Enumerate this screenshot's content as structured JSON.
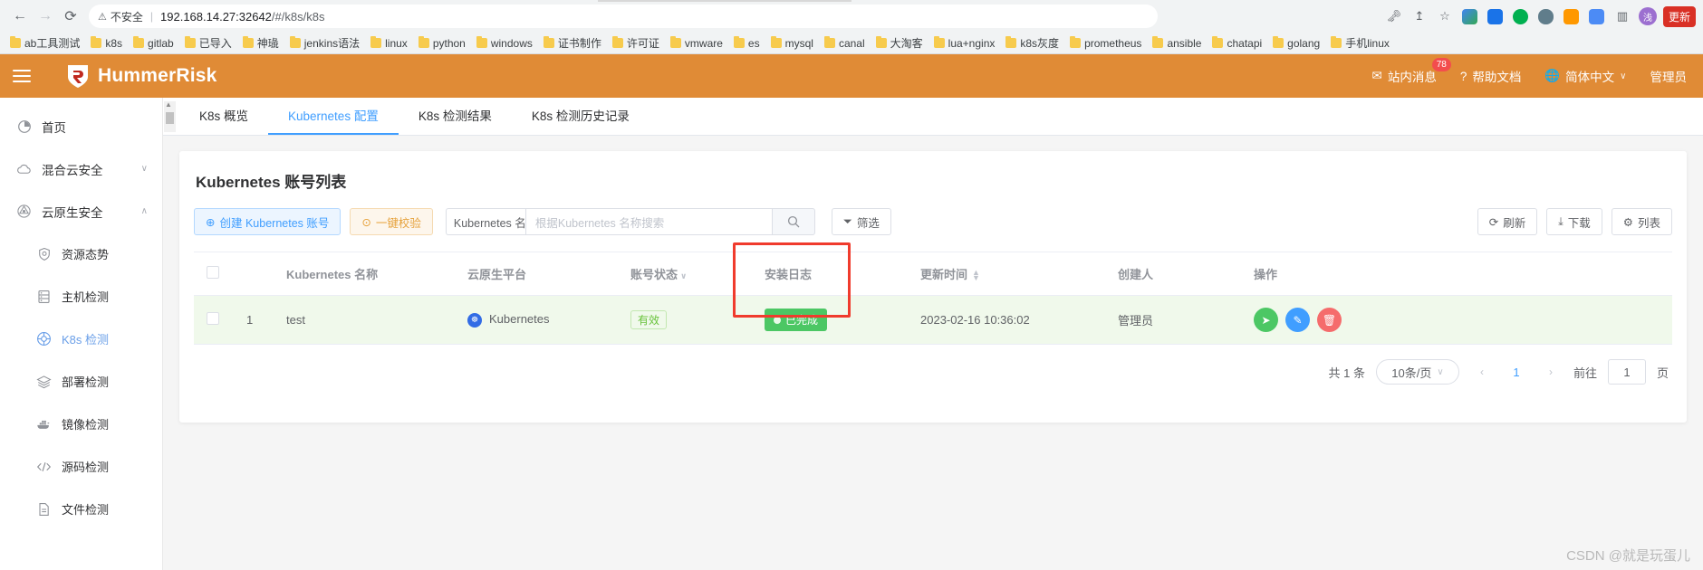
{
  "browser": {
    "back_icon": "arrow-left-icon",
    "forward_icon": "arrow-right-icon",
    "reload_icon": "reload-icon",
    "insecure_label": "不安全",
    "url": "192.168.14.27:32642",
    "url_path": "/#/k8s/k8s",
    "actions": {
      "key_icon": "key-icon",
      "share_icon": "share-icon",
      "star_icon": "star-icon",
      "avatar_initial": "浅",
      "update_label": "更新"
    },
    "bookmarks": [
      "ab工具测试",
      "k8s",
      "gitlab",
      "已导入",
      "神璏",
      "jenkins语法",
      "linux",
      "python",
      "windows",
      "证书制作",
      "许可证",
      "vmware",
      "es",
      "mysql",
      "canal",
      "大淘客",
      "lua+nginx",
      "k8s灰度",
      "prometheus",
      "ansible",
      "chatapi",
      "golang",
      "手机linux"
    ]
  },
  "topbar": {
    "menu_icon": "hamburger-menu-icon",
    "brand": "HummerRisk",
    "messages_label": "站内消息",
    "messages_badge": "78",
    "help_label": "帮助文档",
    "language_label": "简体中文",
    "user_label": "管理员",
    "accent_color": "#e08b36"
  },
  "sidebar": {
    "items": [
      {
        "label": "首页",
        "icon": "dashboard-icon",
        "level": "top",
        "active": false,
        "arrow": ""
      },
      {
        "label": "混合云安全",
        "icon": "cloud-icon",
        "level": "top",
        "active": false,
        "arrow": "∨"
      },
      {
        "label": "云原生安全",
        "icon": "cloud-native-icon",
        "level": "top",
        "active": false,
        "arrow": "∧"
      },
      {
        "label": "资源态势",
        "icon": "shield-icon",
        "level": "sub",
        "active": false,
        "arrow": ""
      },
      {
        "label": "主机检测",
        "icon": "server-icon",
        "level": "sub",
        "active": false,
        "arrow": ""
      },
      {
        "label": "K8s 检测",
        "icon": "kubernetes-icon",
        "level": "sub",
        "active": true,
        "arrow": ""
      },
      {
        "label": "部署检测",
        "icon": "layers-icon",
        "level": "sub",
        "active": false,
        "arrow": ""
      },
      {
        "label": "镜像检测",
        "icon": "docker-icon",
        "level": "sub",
        "active": false,
        "arrow": ""
      },
      {
        "label": "源码检测",
        "icon": "code-icon",
        "level": "sub",
        "active": false,
        "arrow": ""
      },
      {
        "label": "文件检测",
        "icon": "file-icon",
        "level": "sub",
        "active": false,
        "arrow": ""
      }
    ]
  },
  "tabs": [
    {
      "label": "K8s 概览",
      "active": false
    },
    {
      "label": "Kubernetes 配置",
      "active": true
    },
    {
      "label": "K8s 检测结果",
      "active": false
    },
    {
      "label": "K8s 检测历史记录",
      "active": false
    }
  ],
  "card": {
    "title": "Kubernetes 账号列表",
    "toolbar": {
      "create_label": "创建 Kubernetes 账号",
      "create_icon": "plus-circle-icon",
      "validate_label": "一键校验",
      "validate_icon": "play-circle-icon",
      "filter_select_value": "Kubernetes 名",
      "search_placeholder": "根据Kubernetes 名称搜索",
      "search_value": "",
      "search_icon": "search-icon",
      "filter_label": "筛选",
      "filter_icon": "funnel-icon",
      "refresh_label": "刷新",
      "refresh_icon": "refresh-icon",
      "download_label": "下载",
      "download_icon": "download-icon",
      "columns_label": "列表",
      "columns_icon": "gear-icon"
    },
    "table": {
      "headers": [
        {
          "label": "",
          "name": "select-all"
        },
        {
          "label": "",
          "name": "index"
        },
        {
          "label": "Kubernetes 名称",
          "name": "k8s-name"
        },
        {
          "label": "云原生平台",
          "name": "platform"
        },
        {
          "label": "账号状态",
          "name": "account-status",
          "caret": true
        },
        {
          "label": "安装日志",
          "name": "install-log"
        },
        {
          "label": "更新时间",
          "name": "update-time",
          "sortable": true
        },
        {
          "label": "创建人",
          "name": "creator"
        },
        {
          "label": "操作",
          "name": "actions"
        }
      ],
      "rows": [
        {
          "index": "1",
          "name": "test",
          "platform": "Kubernetes",
          "platform_icon": "kubernetes-icon",
          "status": "有效",
          "install_log": "已完成",
          "install_log_icon": "check-circle-icon",
          "update_time": "2023-02-16 10:36:02",
          "creator": "管理员",
          "action_icons": [
            "send-icon",
            "edit-icon",
            "delete-icon"
          ]
        }
      ]
    },
    "pagination": {
      "total_label": "共 1 条",
      "page_size": "10条/页",
      "prev_icon": "chevron-left-icon",
      "current_page": "1",
      "next_icon": "chevron-right-icon",
      "goto_label": "前往",
      "goto_value": "1",
      "page_unit": "页"
    }
  },
  "watermark": "CSDN @就是玩蛋儿"
}
